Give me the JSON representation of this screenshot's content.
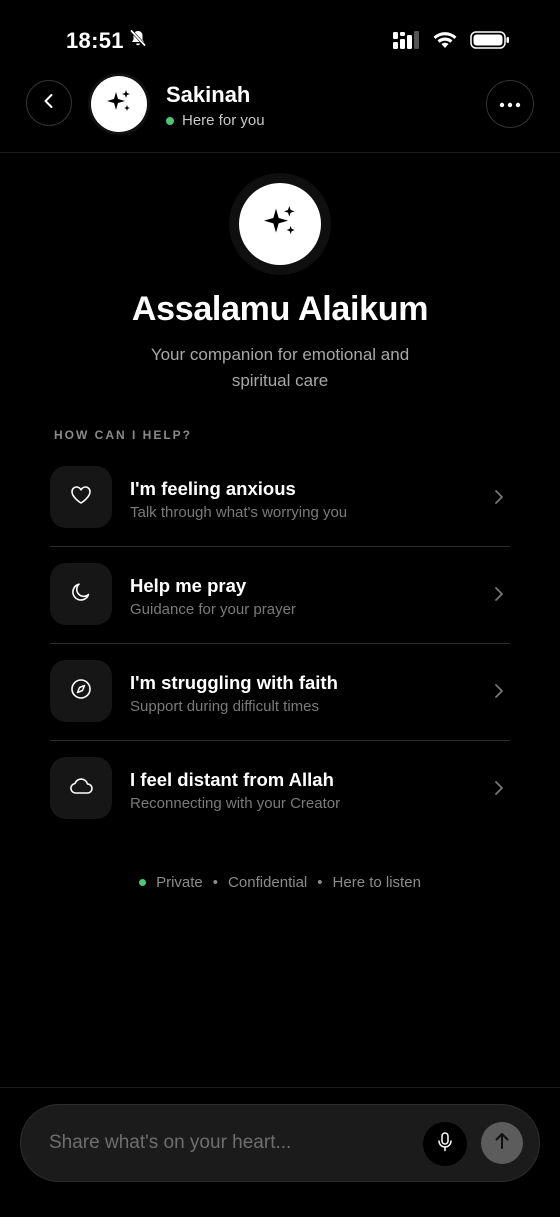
{
  "status_bar": {
    "time": "18:51"
  },
  "header": {
    "name": "Sakinah",
    "status": "Here for you"
  },
  "hero": {
    "title": "Assalamu Alaikum",
    "subtitle": "Your companion for emotional and spiritual care"
  },
  "section_label": "HOW CAN I HELP?",
  "options": [
    {
      "title": "I'm feeling anxious",
      "subtitle": "Talk through what's worrying you",
      "icon": "heart-icon"
    },
    {
      "title": "Help me pray",
      "subtitle": "Guidance for your prayer",
      "icon": "moon-icon"
    },
    {
      "title": "I'm struggling with faith",
      "subtitle": "Support during difficult times",
      "icon": "compass-icon"
    },
    {
      "title": "I feel distant from Allah",
      "subtitle": "Reconnecting with your Creator",
      "icon": "cloud-icon"
    }
  ],
  "footer_note": {
    "private": "Private",
    "confidential": "Confidential",
    "listen": "Here to listen",
    "separator": "•"
  },
  "composer": {
    "placeholder": "Share what's on your heart..."
  },
  "colors": {
    "background": "#000000",
    "online": "#4ec77a",
    "muted_text": "#7a7a7a",
    "send_button": "#5c5c5c"
  }
}
